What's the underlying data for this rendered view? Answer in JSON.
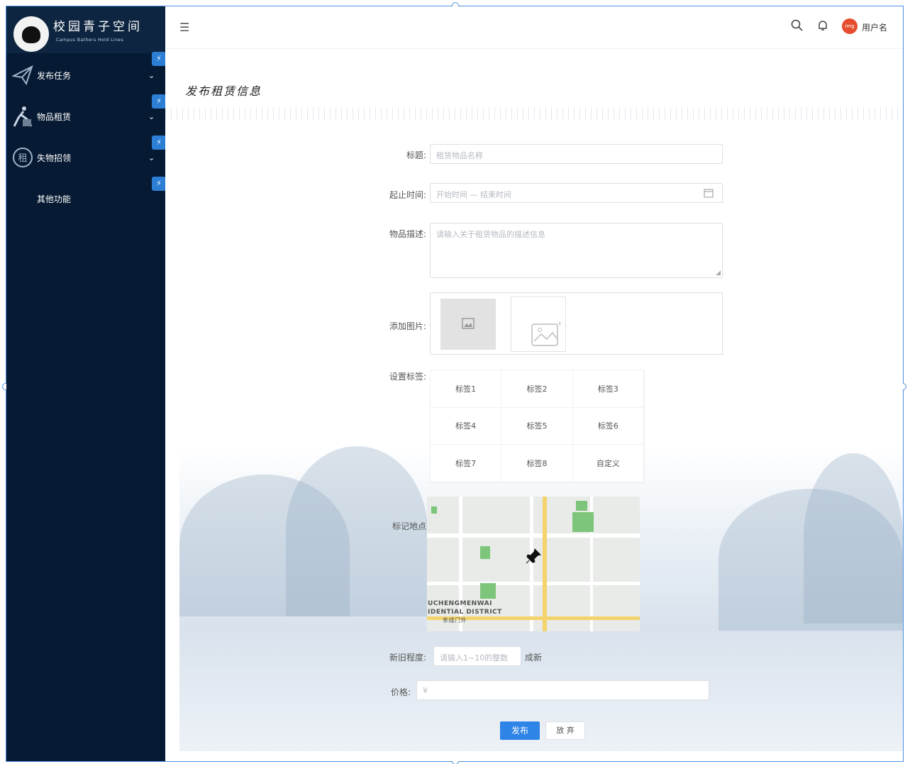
{
  "logo": {
    "title": "校园青子空间",
    "subtitle": "Campus Bathers Hold Lines"
  },
  "sidebar": {
    "items": [
      {
        "label": "发布任务",
        "icon": "paper-plane-icon",
        "chevron": "⌄"
      },
      {
        "label": "物品租赁",
        "icon": "walking-person-icon",
        "chevron": "⌄"
      },
      {
        "label": "失物招领",
        "icon": "seal-icon",
        "chevron": "⌄"
      },
      {
        "label": "其他功能",
        "icon": "",
        "chevron": ""
      }
    ],
    "bolt_glyph": "⚡"
  },
  "header": {
    "menu_icon": "☰",
    "search_icon": "⚲",
    "bell_icon": "🔔",
    "avatar_text": "img",
    "username": "用户名"
  },
  "page": {
    "title": "发布租赁信息"
  },
  "form": {
    "title_label": "标题:",
    "title_placeholder": "租赁物品名称",
    "time_label": "起止时间:",
    "time_placeholder": "开始时间 — 结束时间",
    "desc_label": "物品描述:",
    "desc_placeholder": "请输入关于租赁物品的描述信息",
    "image_label": "添加图片:",
    "tags_label": "设置标签:",
    "tags": [
      "标签1",
      "标签2",
      "标签3",
      "标签4",
      "标签5",
      "标签6",
      "标签7",
      "标签8",
      "自定义"
    ],
    "location_label": "标记地点",
    "map_text_1": "UCHENGMENWAI",
    "map_text_2": "IDENTIAL DISTRICT",
    "map_text_3": "阜成门外",
    "condition_label": "新旧程度:",
    "condition_placeholder": "请输入1~10的整数",
    "condition_suffix": "成新",
    "price_label": "价格:",
    "price_placeholder": "¥",
    "submit_label": "发布",
    "cancel_label": "放 弃"
  },
  "colors": {
    "sidebar_bg": "#061a33",
    "primary": "#2f84e8",
    "accent": "#e54d2e"
  }
}
